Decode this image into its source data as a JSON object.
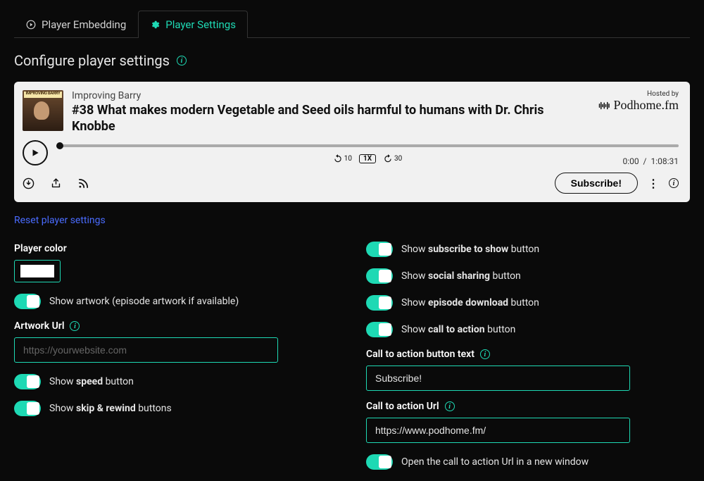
{
  "tabs": {
    "embedding": "Player Embedding",
    "settings": "Player Settings"
  },
  "section_title": "Configure player settings",
  "player": {
    "artwork_label": "IMPROVING BARRY",
    "show_name": "Improving Barry",
    "episode_title": "#38 What makes modern Vegetable and Seed oils harmful to humans with Dr. Chris Knobbe",
    "hosted_by": "Hosted by",
    "host_brand": "Podhome.fm",
    "rewind_label": "10",
    "speed_label": "1X",
    "forward_label": "30",
    "time_current": "0:00",
    "time_total": "1:08:31",
    "time_sep": "/",
    "subscribe": "Subscribe!"
  },
  "reset_link": "Reset player settings",
  "left": {
    "player_color_label": "Player color",
    "show_artwork": "Show artwork (episode artwork if available)",
    "artwork_url_label": "Artwork Url",
    "artwork_url_placeholder": "https://yourwebsite.com",
    "show_speed_pre": "Show ",
    "show_speed_strong": "speed",
    "show_speed_post": " button",
    "show_skip_pre": "Show ",
    "show_skip_strong": "skip & rewind",
    "show_skip_post": " buttons"
  },
  "right": {
    "subscribe_pre": "Show ",
    "subscribe_strong": "subscribe to show",
    "subscribe_post": " button",
    "sharing_pre": "Show ",
    "sharing_strong": "social sharing",
    "sharing_post": " button",
    "download_pre": "Show ",
    "download_strong": "episode download",
    "download_post": " button",
    "cta_pre": "Show ",
    "cta_strong": "call to action",
    "cta_post": " button",
    "cta_text_label": "Call to action button text",
    "cta_text_value": "Subscribe!",
    "cta_url_label": "Call to action Url",
    "cta_url_value": "https://www.podhome.fm/",
    "open_new_window": "Open the call to action Url in a new window"
  }
}
